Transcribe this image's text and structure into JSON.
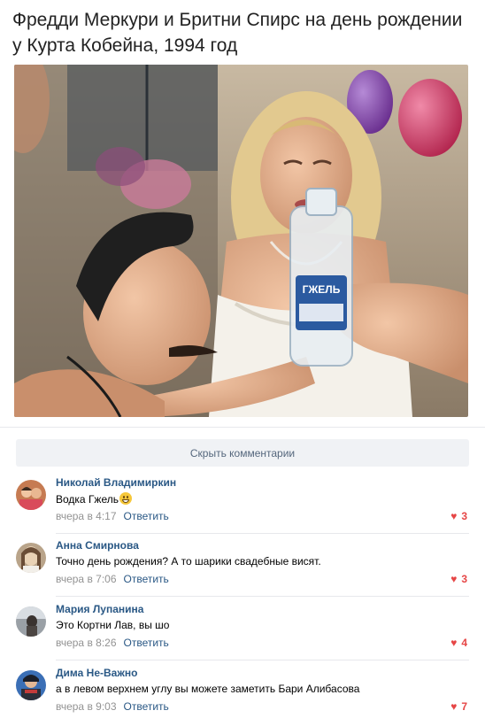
{
  "post": {
    "caption": "Фредди Меркури и Бритни Спирс на день рождении у Курта Кобейна, 1994 год",
    "photo_bottle_label": "ГЖЕЛЬ"
  },
  "comments_toggle": {
    "label": "Скрыть комментарии"
  },
  "comments": [
    {
      "author": "Николай Владимиркин",
      "text": "Водка Гжель",
      "time": "вчера в 4:17",
      "reply": "Ответить",
      "likes": "3"
    },
    {
      "author": "Анна Смирнова",
      "text": "Точно день рождения? А то шарики свадебные висят.",
      "time": "вчера в 7:06",
      "reply": "Ответить",
      "likes": "3"
    },
    {
      "author": "Мария Лупанина",
      "text": "Это Кортни Лав, вы шо",
      "time": "вчера в 8:26",
      "reply": "Ответить",
      "likes": "4"
    },
    {
      "author": "Дима Не-Важно",
      "text": "а в левом верхнем углу вы можете заметить Бари Алибасова",
      "time": "вчера в 9:03",
      "reply": "Ответить",
      "likes": "7"
    }
  ],
  "colors": {
    "link": "#2a5885",
    "like": "#e64646",
    "meta": "#939393",
    "button_bg": "#f0f2f5"
  }
}
